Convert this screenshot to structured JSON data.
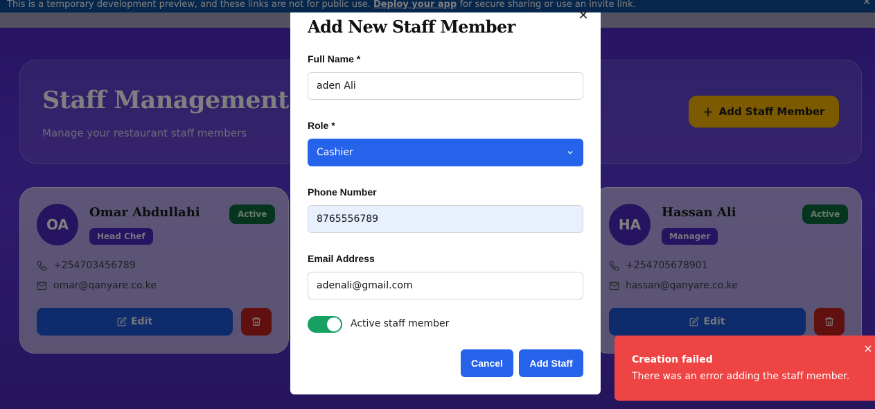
{
  "banner": {
    "text": "This is a temporary development preview, and these links are not for public use.",
    "link": "Deploy your app",
    "suffix": "for secure sharing or use an invite link."
  },
  "page": {
    "title": "Staff Management",
    "subtitle": "Manage your restaurant staff members",
    "add_button": "Add Staff Member"
  },
  "staff": [
    {
      "initials": "OA",
      "name": "Omar Abdullahi",
      "role": "Head Chef",
      "status": "Active",
      "phone": "+254703456789",
      "email": "omar@qanyare.co.ke",
      "edit_label": "Edit"
    },
    {
      "initials": "HA",
      "name": "Hassan Ali",
      "role": "Manager",
      "status": "Active",
      "phone": "+254705678901",
      "email": "hassan@qanyare.co.ke",
      "edit_label": "Edit"
    }
  ],
  "modal": {
    "title": "Add New Staff Member",
    "full_name_label": "Full Name *",
    "full_name_value": "aden Ali",
    "role_label": "Role *",
    "role_value": "Cashier",
    "phone_label": "Phone Number",
    "phone_value": "8765556789",
    "email_label": "Email Address",
    "email_value": "adenali@gmail.com",
    "active_label": "Active staff member",
    "active": true,
    "cancel_label": "Cancel",
    "submit_label": "Add Staff"
  },
  "toast": {
    "title": "Creation failed",
    "message": "There was an error adding the staff member."
  },
  "colors": {
    "primary": "#2563eb",
    "toggle_on": "#16a163",
    "error": "#ef4444",
    "accent": "#f7b500"
  }
}
